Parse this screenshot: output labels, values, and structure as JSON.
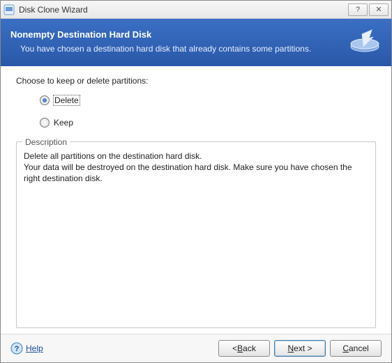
{
  "window": {
    "title": "Disk Clone Wizard"
  },
  "banner": {
    "title": "Nonempty Destination Hard Disk",
    "subtitle": "You have chosen a destination hard disk that already contains some partitions."
  },
  "content": {
    "prompt": "Choose to keep or delete partitions:",
    "radios": {
      "delete": {
        "label": "Delete",
        "selected": true
      },
      "keep": {
        "label": "Keep",
        "selected": false
      }
    },
    "description": {
      "legend": "Description",
      "line1": "Delete all partitions on the destination hard disk.",
      "line2": "Your data will be destroyed on the destination hard disk. Make sure you have chosen the right destination disk."
    }
  },
  "footer": {
    "help": "Help",
    "back_prefix": "< ",
    "back_letter": "B",
    "back_rest": "ack",
    "next_letter": "N",
    "next_rest": "ext >",
    "cancel_letter": "C",
    "cancel_rest": "ancel"
  }
}
